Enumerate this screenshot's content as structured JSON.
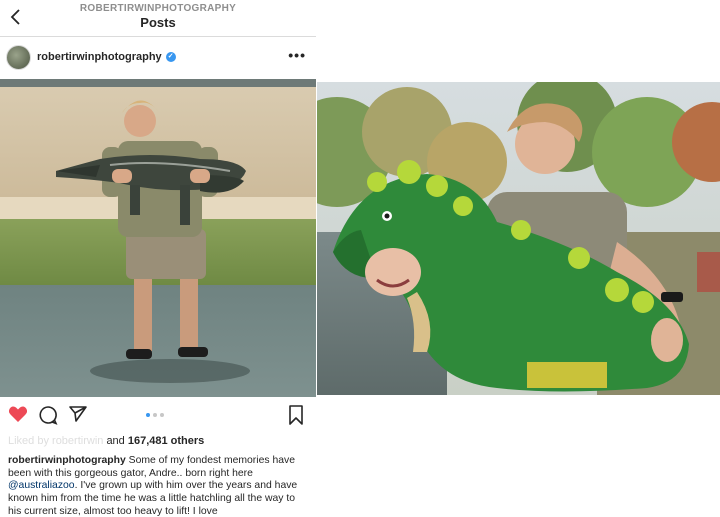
{
  "header": {
    "username_small": "ROBERTIRWINPHOTOGRAPHY",
    "title": "Posts"
  },
  "post": {
    "username": "robertirwinphotography",
    "verified": true,
    "more_label": "•••",
    "likes_prefix": "and ",
    "likes_count": "167,481 others",
    "caption_user": "robertirwinphotography",
    "caption_text_1": " Some of my fondest memories have been with this gorgeous gator, Andre.. born right here ",
    "caption_mention": "@australiazoo",
    "caption_text_2": ". I've grown up with him over the years and have known him from the time he was a little hatchling all the way to his current size, almost too heavy to lift! I love",
    "carousel": {
      "count": 3,
      "active": 0
    },
    "liked": true
  },
  "colors": {
    "heart": "#ed4956",
    "verified": "#3897f0",
    "active_dot": "#3897f0",
    "mention": "#003569"
  },
  "icons": [
    "back-chevron-icon",
    "verified-badge-icon",
    "more-options-icon",
    "heart-icon",
    "comment-icon",
    "share-icon",
    "bookmark-icon"
  ]
}
